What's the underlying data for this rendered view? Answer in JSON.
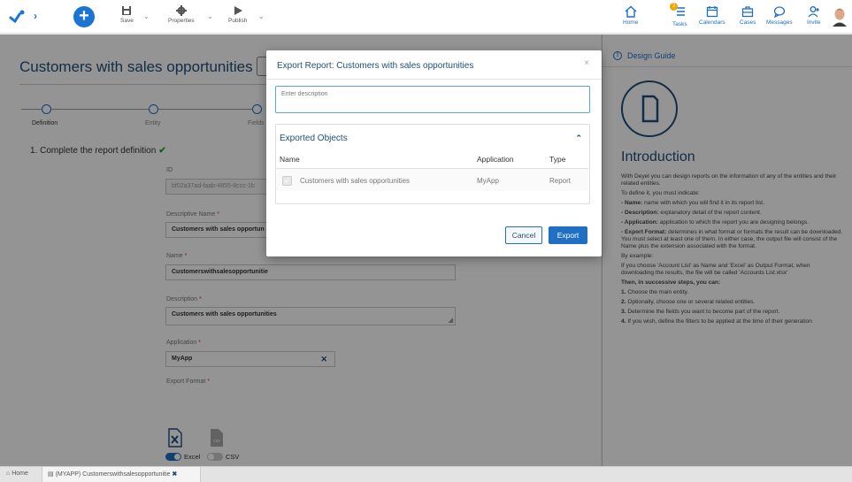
{
  "toolbar": {
    "save": "Save",
    "properties": "Properties",
    "publish": "Publish",
    "home": "Home",
    "tasks": "Tasks",
    "tasks_badge": "2",
    "calendars": "Calendars",
    "cases": "Cases",
    "messages": "Messages",
    "invite": "Invite"
  },
  "page": {
    "title": "Customers with sales opportunities",
    "steps": [
      "Definition",
      "Entity",
      "Fields"
    ],
    "section_title": "1. Complete the report definition",
    "fields": {
      "id_label": "ID",
      "id_value": "bf02a37ad-faab-4855-8ccc-1b",
      "descriptive_name_label": "Descriptive Name",
      "descriptive_name_value": "Customers with sales opportun",
      "name_label": "Name",
      "name_value": "Customerswithsalesopportunitie",
      "description_label": "Description",
      "description_value": "Customers with sales opportunities",
      "application_label": "Application",
      "application_value": "MyApp",
      "export_format_label": "Export Format",
      "excel_label": "Excel",
      "csv_label": "CSV",
      "required_mark": "*"
    }
  },
  "guide": {
    "title": "Design Guide",
    "heading": "Introduction",
    "paragraphs": [
      "With Deyel you can design reports on the information of any of the entities and their related entities.",
      "To define it, you must indicate:"
    ],
    "items": [
      {
        "term": "- Name:",
        "text": " name with which you will find it in its report list."
      },
      {
        "term": "- Description:",
        "text": " explanatory detail of the report content."
      },
      {
        "term": "- Application:",
        "text": " application to which the report you are designing belongs."
      },
      {
        "term": "- Export Format:",
        "text": " determines in what format or formats the result can be downloaded. You must select at least one of them. In either case, the output file will consist of the Name plus the extension associated with the format."
      }
    ],
    "example_intro": "By example:",
    "example": "If you choose 'Account List' as Name and 'Excel' as Output Format, when downloading the results, the file will be called 'Accounts List.xlsx'",
    "steps_title": "Then, in successive steps, you can:",
    "steps": [
      {
        "num": "1.",
        "text": " Choose the main entity."
      },
      {
        "num": "2.",
        "text": " Optionally, choose one or several related entities."
      },
      {
        "num": "3.",
        "text": " Determine the fields you want to become part of the report."
      },
      {
        "num": "4.",
        "text": " If you wish, define the filters to be applied at the time of their generation"
      }
    ]
  },
  "bottom": {
    "home": "Home",
    "tab": "(MYAPP) Customerswithsalesopportunitie"
  },
  "modal": {
    "title": "Export Report: Customers with sales opportunities",
    "close": "×",
    "description_placeholder": "Enter description",
    "panel_title": "Exported Objects",
    "columns": [
      "Name",
      "Application",
      "Type"
    ],
    "rows": [
      {
        "name": "Customers with sales opportunities",
        "application": "MyApp",
        "type": "Report"
      }
    ],
    "cancel": "Cancel",
    "export": "Export"
  },
  "colors": {
    "accent": "#1f6fc4",
    "title": "#1f4e79",
    "check": "#2e9b2e",
    "badge": "#f0a500"
  }
}
